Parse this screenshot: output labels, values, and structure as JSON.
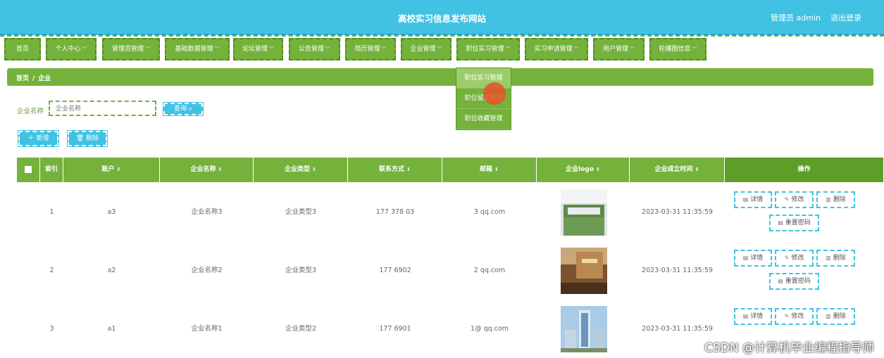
{
  "header": {
    "title": "高校实习信息发布网站",
    "user": "管理员 admin",
    "logout": "退出登录"
  },
  "nav": {
    "items": [
      {
        "label": "首页"
      },
      {
        "label": "个人中心"
      },
      {
        "label": "管理员管理"
      },
      {
        "label": "基础数据管理"
      },
      {
        "label": "论坛管理"
      },
      {
        "label": "公告管理"
      },
      {
        "label": "简历管理"
      },
      {
        "label": "企业管理"
      },
      {
        "label": "职位实习管理"
      },
      {
        "label": "实习申请管理"
      },
      {
        "label": "用户管理"
      },
      {
        "label": "轮播图信息"
      }
    ]
  },
  "breadcrumb": {
    "home": "首页",
    "sep": "/",
    "current": "企业"
  },
  "dropdown": {
    "items": [
      "职位实习管理",
      "职位留言管理",
      "职位收藏管理"
    ]
  },
  "search": {
    "label": "企业名称",
    "placeholder": "企业名称",
    "button": "查询"
  },
  "toolbar": {
    "add": "新增",
    "delete": "删除"
  },
  "table": {
    "headers": {
      "index": "索引",
      "account": "账户",
      "name": "企业名称",
      "type": "企业类型",
      "contact": "联系方式",
      "email": "邮箱",
      "logo": "企业logo",
      "founded": "企业成立时间",
      "ops": "操作"
    },
    "rows": [
      {
        "index": "1",
        "account": "a3",
        "name": "企业名称3",
        "type": "企业类型3",
        "contact": "177 378 03",
        "email": "3 qq.com",
        "founded": "2023-03-31 11:35:59"
      },
      {
        "index": "2",
        "account": "a2",
        "name": "企业名称2",
        "type": "企业类型3",
        "contact": "177 6902",
        "email": "2 qq.com",
        "founded": "2023-03-31 11:35:59"
      },
      {
        "index": "3",
        "account": "a1",
        "name": "企业名称1",
        "type": "企业类型2",
        "contact": "177 6901",
        "email": "1@ qq.com",
        "founded": "2023-03-31 11:35:59"
      }
    ],
    "actions": {
      "detail": "详情",
      "edit": "修改",
      "delete": "删除",
      "reset": "重置密码"
    }
  },
  "watermark": "CSDN @计算机毕业编程指导师",
  "colors": {
    "header": "#41c2e3",
    "nav": "#74b23c",
    "accent_blue": "#41c2e3"
  }
}
